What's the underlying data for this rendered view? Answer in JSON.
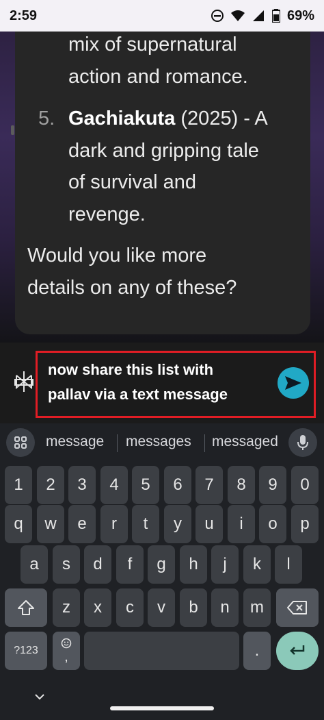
{
  "status_bar": {
    "time": "2:59",
    "battery": "69%",
    "icons": [
      "do-not-disturb-icon",
      "wifi-icon",
      "cell-signal-icon",
      "battery-icon"
    ]
  },
  "chat": {
    "lines": [
      "mix of supernatural",
      "action and romance."
    ],
    "item5": {
      "number": "5.",
      "title": "Gachiakuta",
      "rest": " (2025) - A",
      "lines": [
        "dark and gripping tale",
        "of survival and",
        "revenge."
      ]
    },
    "question_lines": [
      "Would you like more",
      "details on any of these?"
    ]
  },
  "input": {
    "text_line1": "now share this list with",
    "text_line2": "pallav via a text message",
    "send_icon": "send-icon",
    "logo_icon": "perplexity-logo-icon"
  },
  "keyboard": {
    "suggestions": [
      "message",
      "messages",
      "messaged"
    ],
    "number_row": [
      "1",
      "2",
      "3",
      "4",
      "5",
      "6",
      "7",
      "8",
      "9",
      "0"
    ],
    "row1": [
      "q",
      "w",
      "e",
      "r",
      "t",
      "y",
      "u",
      "i",
      "o",
      "p"
    ],
    "row2": [
      "a",
      "s",
      "d",
      "f",
      "g",
      "h",
      "j",
      "k",
      "l"
    ],
    "row3": [
      "z",
      "x",
      "c",
      "v",
      "b",
      "n",
      "m"
    ],
    "symbols_label": "?123",
    "emoji_sub": ",",
    "period": ".",
    "accent_color": "#8bc9b9"
  },
  "colors": {
    "send_button": "#21a9c6",
    "input_highlight": "#e11d25"
  }
}
